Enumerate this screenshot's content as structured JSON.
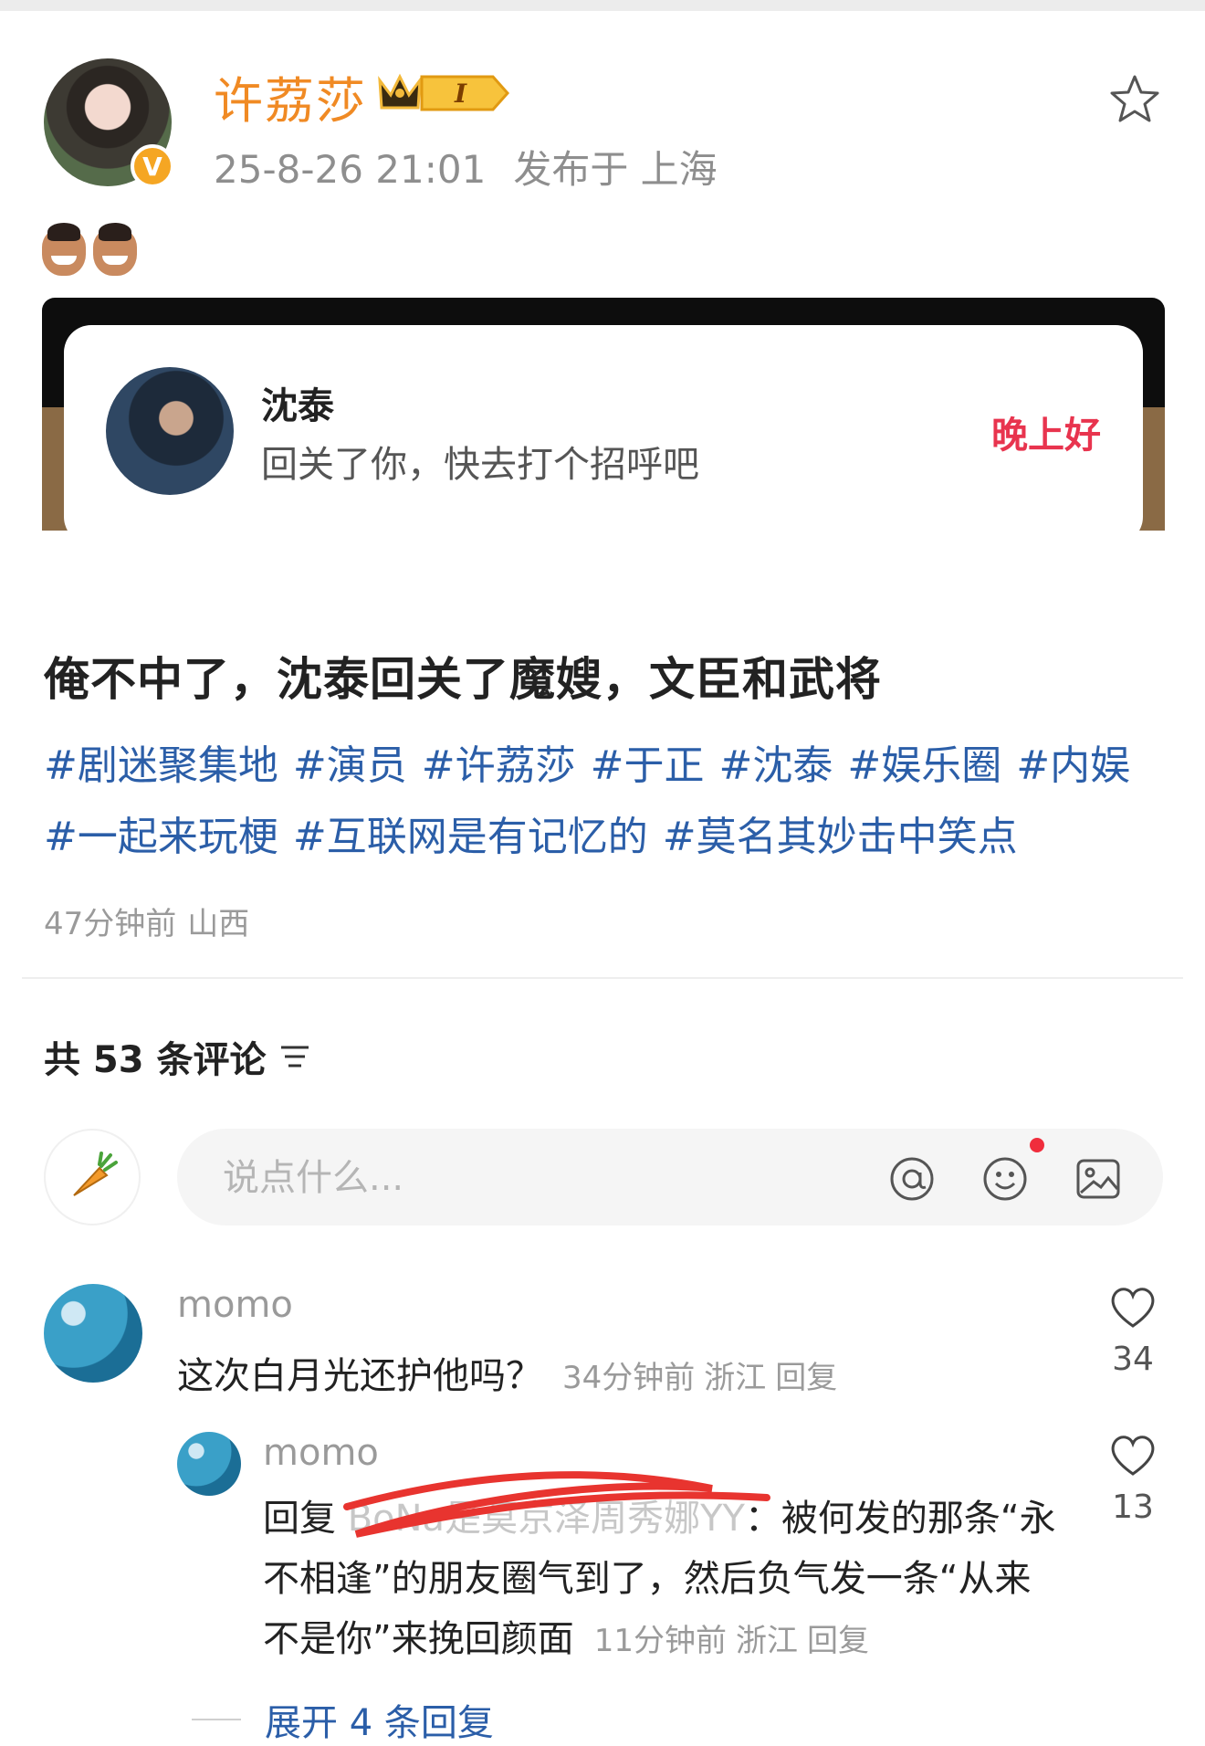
{
  "post": {
    "username": "许荔莎",
    "vip_level": "I",
    "date": "25-8-26 21:01",
    "location": "发布于 上海",
    "screenshot": {
      "name": "沈泰",
      "message": "回关了你，快去打个招呼吧",
      "greeting": "晚上好"
    },
    "text": "俺不中了，沈泰回关了魔嫂，文臣和武将",
    "tags": [
      "#剧迷聚集地",
      "#演员",
      "#许荔莎",
      "#于正",
      "#沈泰",
      "#娱乐圈",
      "#内娱",
      "#一起来玩梗",
      "#互联网是有记忆的",
      "#莫名其妙击中笑点"
    ],
    "meta_time": "47分钟前",
    "meta_location": "山西"
  },
  "comments_header": {
    "label": "共 53 条评论"
  },
  "input": {
    "placeholder": "说点什么..."
  },
  "comments": [
    {
      "user": "momo",
      "text": "这次白月光还护他吗？",
      "time": "34分钟前",
      "location": "浙江",
      "reply_label": "回复",
      "likes": "34"
    },
    {
      "user": "momo",
      "prefix": "回复",
      "hidden_name": "BoNa是莫京泽周秀娜YY",
      "text": "：被何发的那条“永不相逢”的朋友圈气到了，然后负气发一条“从来不是你”来挽回颜面",
      "time": "11分钟前",
      "location": "浙江",
      "reply_label": "回复",
      "likes": "13"
    }
  ],
  "expand": {
    "label": "展开 4 条回复"
  },
  "colors": {
    "username": "#f08a24",
    "tag": "#2b5ea8",
    "greeting": "#e8344e",
    "badge": "#f5a623"
  },
  "icons": [
    "star-icon",
    "verified-icon",
    "crown-icon",
    "filter-icon",
    "carrot-icon",
    "at-icon",
    "emoji-icon",
    "image-icon",
    "heart-icon"
  ]
}
